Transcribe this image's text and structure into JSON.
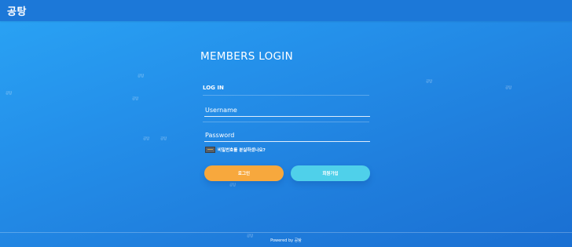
{
  "header": {
    "brand": "공탕"
  },
  "login": {
    "title": "MEMBERS LOGIN",
    "section_label": "LOG IN",
    "username_placeholder": "Username",
    "password_placeholder": "Password",
    "forgot_password": "비밀번호를 분실하셨나요?",
    "login_button": "로그인",
    "signup_button": "회원가입"
  },
  "watermarks": [
    "공탕",
    "공탕",
    "공탕",
    "공탕",
    "공탕",
    "공탕",
    "공탕",
    "공탕",
    "공탕"
  ],
  "footer": {
    "powered_by": "Powered by 공탕"
  },
  "colors": {
    "background_top": "#2aa4f5",
    "background_bottom": "#1a6fd2",
    "header_bar": "#1c78d8",
    "login_button": "#f7a83d",
    "signup_button": "#4fd0ea"
  }
}
